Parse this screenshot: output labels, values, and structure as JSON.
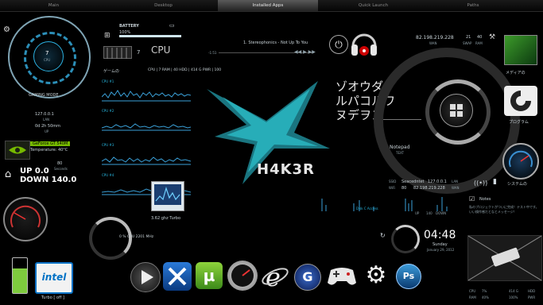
{
  "tabs": [
    "Main",
    "Desktop",
    "Installed Apps",
    "Quick Launch",
    "Paths"
  ],
  "active_tab": 2,
  "left": {
    "gaming_mode": "GAMING MODE",
    "cpu_value": "7",
    "cpu_label": "CPU",
    "lan_ip": "127.0.0.1",
    "lan_label": "LAN",
    "uptime": "0d 2h 50mm",
    "uptime_label": "UP",
    "gpu_name": "GeForce GT 540M",
    "gpu_temp": "Temperature: 40°C",
    "up_value": "80",
    "up_unit": "Seconds",
    "up_text": "UP 0.0",
    "down_text": "DOWN 140.0",
    "turbo": "Turbo [ off ]"
  },
  "battery": {
    "label": "BATTERY",
    "value": "100%",
    "level": 1.0
  },
  "cpu_panel": {
    "cores": "7",
    "label": "CPU",
    "title": "ゲームの",
    "stats": "CPU | 7    RAM | 40    HDD | 414 G  PWR | 100",
    "graph_labels": [
      "CPU #1",
      "CPU #2",
      "CPU #3",
      "CPU #4"
    ],
    "turbo_text": "3.62 ghz Turbo",
    "freq_text": "0 %    CPU 2201 MHz"
  },
  "music": {
    "track": "1. Stereophonics - Not Up To You",
    "time": "-1:51"
  },
  "center_logo": "H4K3R",
  "japanese_text": [
    "ゾオウダ",
    "ルパコルワ",
    "ヌデヲン"
  ],
  "net": {
    "ip": "82.198.219.228",
    "wan_label": "WAN",
    "swap": "21",
    "ram": "40",
    "swap_label": "SWAP",
    "ram_label": "RAM"
  },
  "right_icons": [
    "メディアの",
    "プログラム",
    "システムの"
  ],
  "notepad": {
    "label": "Notepad",
    "sub": "TEXT"
  },
  "wifi_panel": {
    "ssid_label": "SSID",
    "ssid": "Seacedntet",
    "lan_ip": "127.0.0.1",
    "lan_label": "LAN",
    "wifi_label": "WiFi",
    "wifi_value": "80",
    "wan_ip": "82.198.219.228",
    "wan_label": "WAN",
    "up": "UP",
    "down": "DOWN",
    "down_value": "140",
    "disk_label": "Disk C Access"
  },
  "clock": {
    "time": "04:48",
    "day": "Sunday",
    "date": "January 29, 2012"
  },
  "notes": {
    "title": "Notes",
    "text": "私のプロジェクトがついに完成！テスト中です。いい操作感だとなとメッセージ！"
  },
  "bottom_stats": {
    "cpu_label": "CPU",
    "cpu_value": "7%",
    "ram_label": "RAM",
    "ram_value": "40%",
    "hdd_value": "414 G",
    "pwr_value": "100%",
    "hdd_label": "HDD",
    "pwr_label": "PWR"
  },
  "dock": [
    "play-icon",
    "tools-icon",
    "utorrent-icon",
    "gauge-icon",
    "ie-icon",
    "google-icon",
    "gamepad-icon",
    "settings-icon",
    "photoshop-icon"
  ],
  "colors": {
    "accent": "#27b6e0",
    "logo": "#2ec4d0"
  }
}
